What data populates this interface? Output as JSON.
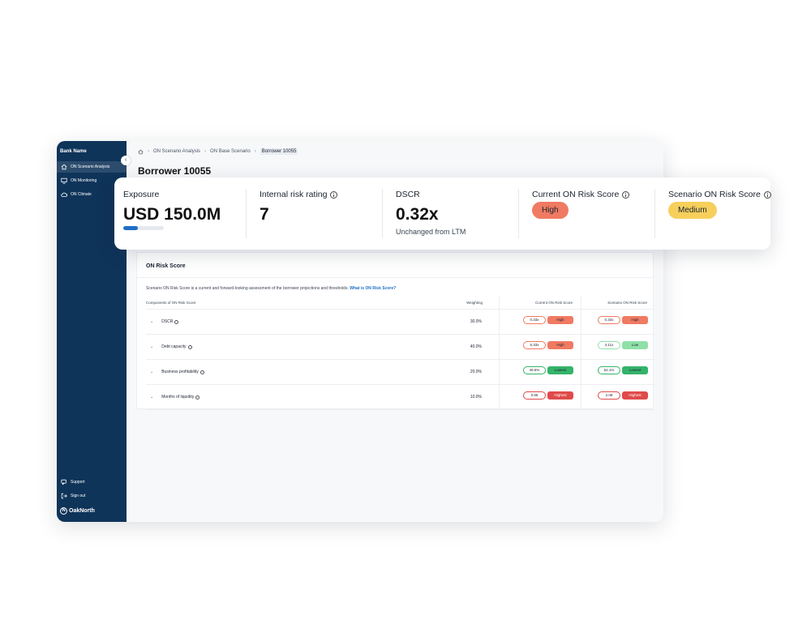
{
  "sidebar": {
    "bank_name": "Bank Name",
    "items": [
      {
        "label": "ON Scenario Analysis",
        "icon": "home-icon"
      },
      {
        "label": "ON Monitoring",
        "icon": "monitor-icon"
      },
      {
        "label": "ON Climate",
        "icon": "cloud-icon"
      }
    ],
    "support": "Support",
    "sign_out": "Sign out",
    "brand": "OakNorth"
  },
  "breadcrumb": [
    "ON Scenario Analysis",
    "ON Base Scenario",
    "Borrower 10055"
  ],
  "page_title": "Borrower 10055",
  "summary": {
    "exposure": {
      "label": "Exposure",
      "value": "USD 150.0M",
      "progress": 0.35
    },
    "internal_rating": {
      "label": "Internal risk rating",
      "value": "7"
    },
    "dscr": {
      "label": "DSCR",
      "value": "0.32x",
      "sub": "Unchanged from LTM"
    },
    "current_score": {
      "label": "Current ON Risk Score",
      "badge": "High"
    },
    "scenario_score": {
      "label": "Scenario ON Risk Score",
      "badge": "Medium"
    }
  },
  "risk_panel": {
    "title": "ON Risk Score",
    "description": "Scenario ON Risk Score is a current and forward-looking assessment of the borrower projections and thresholds.",
    "link": "What is ON Risk Score?",
    "columns": {
      "component": "Components of ON Risk Score",
      "weighting": "Weighting",
      "current": "Current ON Risk Score",
      "scenario": "Scenario ON Risk Score"
    },
    "rows": [
      {
        "name": "DSCR",
        "weighting": "30.0%",
        "cur_val": "0.33x",
        "cur_level": "High",
        "scn_val": "0.32x",
        "scn_level": "High"
      },
      {
        "name": "Debt capacity",
        "weighting": "40.0%",
        "cur_val": "5.33x",
        "cur_level": "High",
        "scn_val": "4.11x",
        "scn_level": "Low"
      },
      {
        "name": "Business profitability",
        "weighting": "20.0%",
        "cur_val": "49.5%",
        "cur_level": "Lowest",
        "scn_val": "52.1%",
        "scn_level": "Lowest"
      },
      {
        "name": "Months of liquidity",
        "weighting": "10.0%",
        "cur_val": "0.85",
        "cur_level": "Highest",
        "scn_val": "2.08",
        "scn_level": "Highest"
      }
    ]
  },
  "colors": {
    "sidebar_bg": "#0f3459",
    "accent_blue": "#1f6fc6",
    "high": "#f07a62",
    "highest": "#e04a4a",
    "medium": "#f7cf5b",
    "low": "#8fe0a8",
    "lowest": "#34b36a"
  }
}
